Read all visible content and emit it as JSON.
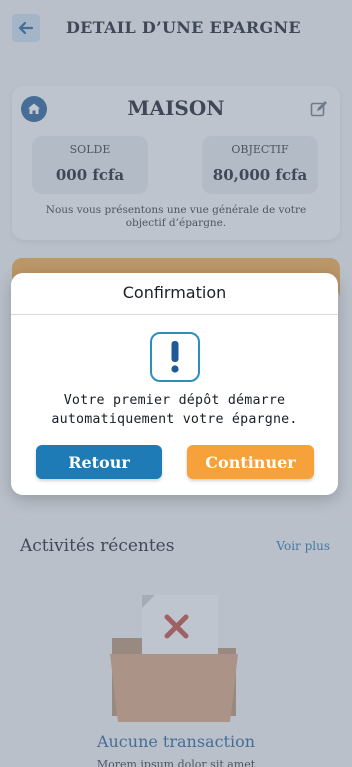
{
  "header": {
    "title": "DETAIL D’UNE EPARGNE"
  },
  "savings": {
    "name": "MAISON",
    "balance_label": "SOLDE",
    "balance_value": "000 fcfa",
    "goal_label": "OBJECTIF",
    "goal_value": "80,000 fcfa",
    "description": "Nous vous présentons une vue générale de votre objectif d’épargne."
  },
  "recent": {
    "title": "Activités récentes",
    "see_more": "Voir plus",
    "empty_title": "Aucune transaction",
    "empty_subtitle": "Morem ipsum dolor sit amet"
  },
  "modal": {
    "title": "Confirmation",
    "message": "Votre premier dépôt démarre automatiquement votre épargne.",
    "back_label": "Retour",
    "continue_label": "Continuer"
  },
  "colors": {
    "primary": "#1f7bb5",
    "accent": "#f7a13a",
    "dark_blue": "#1d5a96",
    "overlay": "rgba(120,132,150,0.45)"
  },
  "icons": [
    "back-arrow-icon",
    "home-icon",
    "edit-icon",
    "alert-icon",
    "empty-folder-icon"
  ]
}
